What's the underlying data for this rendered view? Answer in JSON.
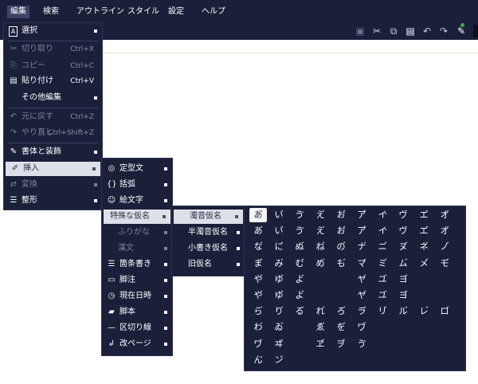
{
  "menubar": [
    "編集",
    "検索",
    "アウトライン",
    "スタイル",
    "設定",
    "ヘルプ"
  ],
  "edit_menu": {
    "items": [
      {
        "icon": "A",
        "label": "選択",
        "shortcut": ""
      },
      {
        "icon": "✂",
        "label": "切り取り",
        "shortcut": "Ctrl+X"
      },
      {
        "icon": "⎘",
        "label": "コピー",
        "shortcut": "Ctrl+C"
      },
      {
        "icon": "▤",
        "label": "貼り付け",
        "shortcut": "Ctrl+V"
      },
      {
        "icon": "",
        "label": "その他編集",
        "shortcut": ""
      },
      {
        "icon": "↶",
        "label": "元に戻す",
        "shortcut": "Ctrl+Z"
      },
      {
        "icon": "↷",
        "label": "やり直し",
        "shortcut": "Ctrl+Shift+Z"
      },
      {
        "icon": "✎",
        "label": "書体と装飾",
        "shortcut": ""
      },
      {
        "icon": "✐",
        "label": "挿入",
        "shortcut": ""
      },
      {
        "icon": "⇄",
        "label": "変換",
        "shortcut": ""
      },
      {
        "icon": "☰",
        "label": "整形",
        "shortcut": ""
      }
    ]
  },
  "insert_menu": {
    "items": [
      {
        "icon": "◎",
        "label": "定型文"
      },
      {
        "icon": "{}",
        "label": "括弧"
      },
      {
        "icon": "☺",
        "label": "絵文字"
      },
      {
        "icon": "",
        "label": "特殊な仮名"
      },
      {
        "icon": "",
        "label": "ふりがな"
      },
      {
        "icon": "",
        "label": "漢文"
      },
      {
        "icon": "☰",
        "label": "箇条書き"
      },
      {
        "icon": "▭",
        "label": "脚注"
      },
      {
        "icon": "◷",
        "label": "現在日時"
      },
      {
        "icon": "▰",
        "label": "脚本"
      },
      {
        "icon": "—",
        "label": "区切り線"
      },
      {
        "icon": "↲",
        "label": "改ページ"
      }
    ]
  },
  "kana_menu": {
    "items": [
      "濁音仮名",
      "半濁音仮名",
      "小書き仮名",
      "旧仮名"
    ]
  },
  "kana_grid": {
    "rows": [
      [
        "あ゙",
        "い゙",
        "ゔ",
        "え゙",
        "お゙",
        "ア゙",
        "イ゙",
        "ヴ",
        "エ゙",
        "オ゙"
      ],
      [
        "あ゙",
        "い゙",
        "ゔ",
        "え゙",
        "お゙",
        "ア゙",
        "イ゙",
        "ヴ",
        "エ゙",
        "オ゙"
      ],
      [
        "な゙",
        "に゙",
        "ぬ゙",
        "ね゙",
        "の゙",
        "ナ゙",
        "ニ゙",
        "ヌ゙",
        "ネ゙",
        "ノ゙"
      ],
      [
        "ま゙",
        "み゙",
        "む゙",
        "め゙",
        "も゙",
        "マ゙",
        "ミ゙",
        "ム゙",
        "メ゙",
        "モ゙"
      ],
      [
        "や゙",
        "ゆ゙",
        "よ゙",
        "",
        "",
        "ヤ゙",
        "ユ゙",
        "ヨ゙",
        "",
        ""
      ],
      [
        "や゙",
        "ゆ゙",
        "よ゙",
        "",
        "",
        "ヤ゙",
        "ユ゙",
        "ヨ゙",
        "",
        ""
      ],
      [
        "ら゙",
        "り゙",
        "る゙",
        "れ゙",
        "ろ゙",
        "ラ゙",
        "リ゙",
        "ル゙",
        "レ゙",
        "ロ゙"
      ],
      [
        "わ゙",
        "ゐ゙",
        "",
        "ゑ゙",
        "を゙",
        "ヷ",
        "",
        "",
        "",
        ""
      ],
      [
        "ヷ",
        "ヸ",
        "",
        "ヹ",
        "ヺ",
        "ゔ",
        "",
        "",
        "",
        ""
      ],
      [
        "ん゙",
        "ン゙",
        "",
        "",
        "",
        "",
        "",
        "",
        "",
        ""
      ]
    ]
  },
  "colors": {
    "menu_bg": "#1b1f3a",
    "highlight": "#dde0e8",
    "disabled": "#7c8198"
  }
}
